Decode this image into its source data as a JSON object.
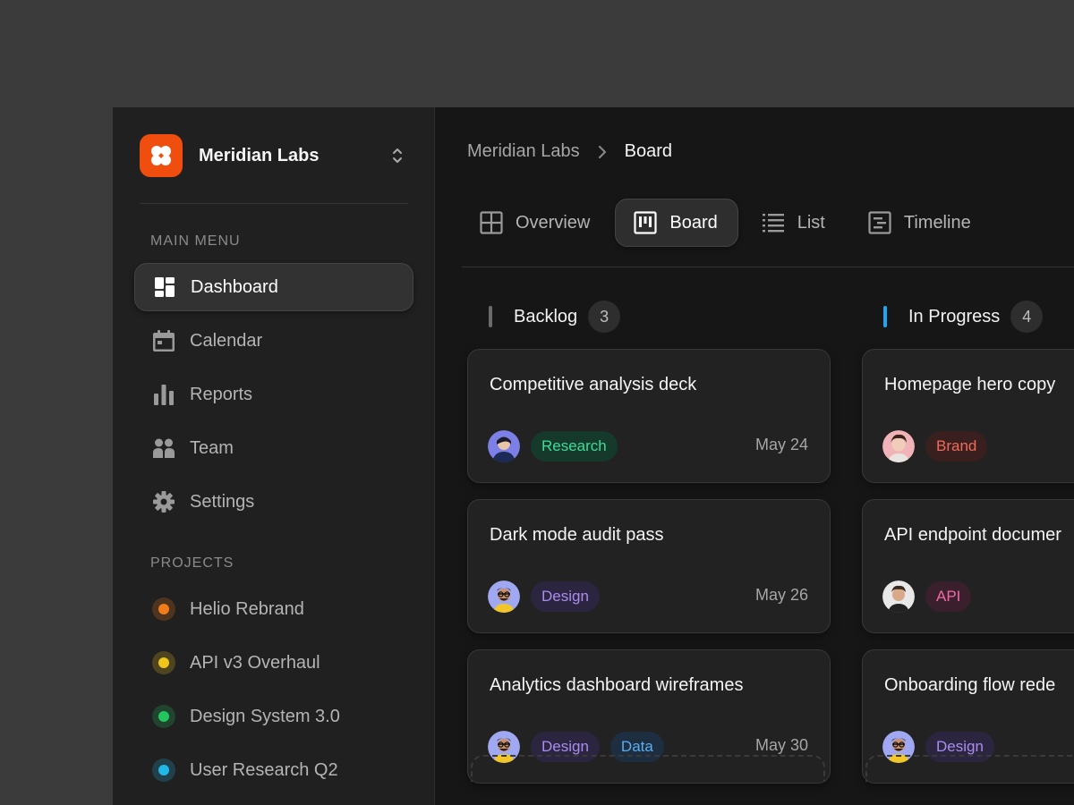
{
  "workspace": {
    "name": "Meridian Labs",
    "logo_color": "#f04e0e"
  },
  "sidebar": {
    "main_menu_label": "MAIN MENU",
    "items": [
      {
        "label": "Dashboard",
        "icon": "dashboard-icon",
        "active": true
      },
      {
        "label": "Calendar",
        "icon": "calendar-icon"
      },
      {
        "label": "Reports",
        "icon": "bar-chart-icon"
      },
      {
        "label": "Team",
        "icon": "team-icon"
      },
      {
        "label": "Settings",
        "icon": "gear-icon"
      }
    ],
    "projects_label": "PROJECTS",
    "projects": [
      {
        "label": "Helio Rebrand",
        "color": "#f07c1a"
      },
      {
        "label": "API v3 Overhaul",
        "color": "#f0c41a"
      },
      {
        "label": "Design System 3.0",
        "color": "#22c55e"
      },
      {
        "label": "User Research Q2",
        "color": "#22b8e6"
      }
    ]
  },
  "breadcrumb": {
    "root": "Meridian Labs",
    "current": "Board"
  },
  "tabs": [
    {
      "label": "Overview",
      "icon": "grid-icon"
    },
    {
      "label": "Board",
      "icon": "kanban-icon",
      "active": true
    },
    {
      "label": "List",
      "icon": "list-icon"
    },
    {
      "label": "Timeline",
      "icon": "timeline-icon"
    }
  ],
  "columns": [
    {
      "title": "Backlog",
      "count": "3",
      "accent": "#6b6b6b",
      "cards": [
        {
          "title": "Competitive analysis deck",
          "avatar": "avatar-blue",
          "tags": [
            "Research"
          ],
          "date": "May 24"
        },
        {
          "title": "Dark mode audit pass",
          "avatar": "avatar-glasses",
          "tags": [
            "Design"
          ],
          "date": "May 26"
        },
        {
          "title": "Analytics dashboard wireframes",
          "avatar": "avatar-glasses",
          "tags": [
            "Design",
            "Data"
          ],
          "date": "May 30"
        }
      ]
    },
    {
      "title": "In Progress",
      "count": "4",
      "accent": "#1ea7f0",
      "cards": [
        {
          "title": "Homepage hero copy",
          "avatar": "avatar-pink",
          "tags": [
            "Brand"
          ]
        },
        {
          "title": "API endpoint documer",
          "avatar": "avatar-man",
          "tags": [
            "API"
          ]
        },
        {
          "title": "Onboarding flow rede",
          "avatar": "avatar-glasses",
          "tags": [
            "Design"
          ]
        }
      ]
    }
  ],
  "tag_colors": {
    "Research": {
      "bg": "#153a2c",
      "fg": "#3ddc97"
    },
    "Design": {
      "bg": "#2c2540",
      "fg": "#a98cf0"
    },
    "Data": {
      "bg": "#1c2e40",
      "fg": "#5aaef0"
    },
    "Brand": {
      "bg": "#3a1f1f",
      "fg": "#f06a5a"
    },
    "API": {
      "bg": "#3a1f2c",
      "fg": "#f06aa6"
    }
  }
}
